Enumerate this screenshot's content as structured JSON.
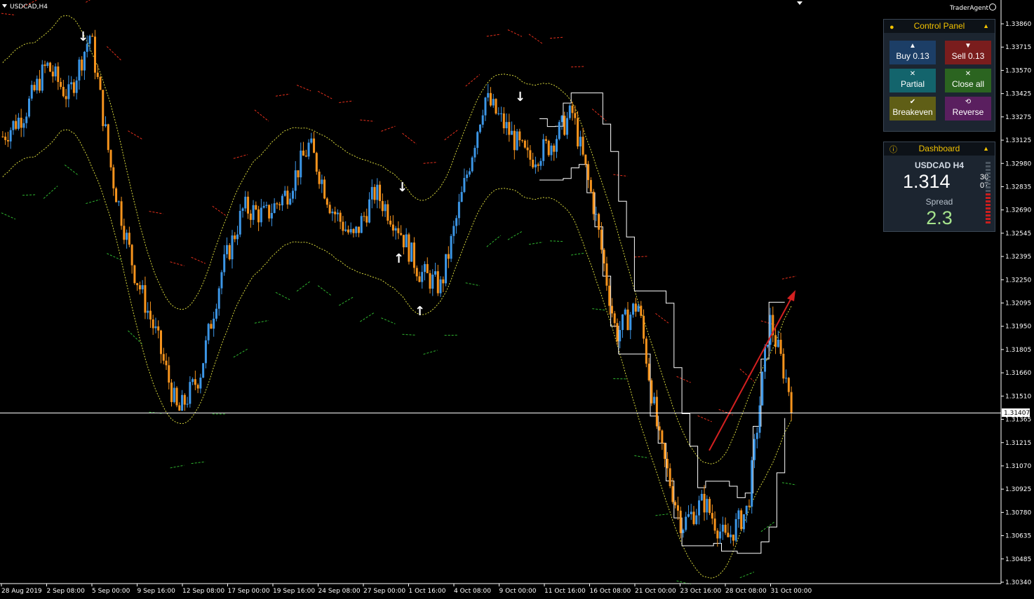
{
  "chart": {
    "title": "USDCAD,H4",
    "brand": "TraderAgent",
    "current_price_label": "1.31407",
    "price_levels": [
      "1.33860",
      "1.33715",
      "1.33570",
      "1.33425",
      "1.33275",
      "1.33125",
      "1.32980",
      "1.32835",
      "1.32690",
      "1.32545",
      "1.32395",
      "1.32250",
      "1.32095",
      "1.31950",
      "1.31805",
      "1.31660",
      "1.31510",
      "1.31365",
      "1.31215",
      "1.31070",
      "1.30925",
      "1.30780",
      "1.30635",
      "1.30485",
      "1.30340"
    ],
    "time_labels": [
      "28 Aug 2019",
      "2 Sep 08:00",
      "5 Sep 00:00",
      "9 Sep 16:00",
      "12 Sep 08:00",
      "17 Sep 00:00",
      "19 Sep 16:00",
      "24 Sep 08:00",
      "27 Sep 00:00",
      "1 Oct 16:00",
      "4 Oct 08:00",
      "9 Oct 00:00",
      "11 Oct 16:00",
      "16 Oct 08:00",
      "21 Oct 00:00",
      "23 Oct 16:00",
      "28 Oct 08:00",
      "31 Oct 00:00"
    ],
    "colors": {
      "bull": "#3c96e6",
      "bear": "#f7941d",
      "grid_line": "#ffffff",
      "resistance": "#e8301c",
      "support": "#2fb52f",
      "envelope": "#d8d83c",
      "trend_arrow": "#d42020"
    }
  },
  "chart_data": {
    "type": "candlestick",
    "symbol": "USDCAD",
    "timeframe": "H4",
    "ylim": [
      1.3034,
      1.3386
    ],
    "close_path": [
      1.3315,
      1.333,
      1.336,
      1.334,
      1.338,
      1.329,
      1.323,
      1.319,
      1.314,
      1.3165,
      1.323,
      1.327,
      1.3265,
      1.328,
      1.331,
      1.327,
      1.325,
      1.328,
      1.326,
      1.323,
      1.322,
      1.328,
      1.334,
      1.332,
      1.33,
      1.331,
      1.333,
      1.327,
      1.319,
      1.321,
      1.312,
      1.307,
      1.3085,
      1.306,
      1.308,
      1.32,
      1.315
    ],
    "current_price": 1.31407,
    "signal_arrows": [
      {
        "direction": "down",
        "price": 1.3378
      },
      {
        "direction": "down",
        "price": 1.334
      },
      {
        "direction": "down",
        "price": 1.3283
      },
      {
        "direction": "up",
        "price": 1.3238
      },
      {
        "direction": "up",
        "price": 1.3205
      }
    ]
  },
  "control_panel": {
    "title": "Control Panel",
    "buttons": [
      {
        "icon": "▲",
        "label": "Buy 0.13",
        "color": "#1c3e66"
      },
      {
        "icon": "▼",
        "label": "Sell 0.13",
        "color": "#7a1d1d"
      },
      {
        "icon": "✕",
        "label": "Partial",
        "color": "#13646c"
      },
      {
        "icon": "✕",
        "label": "Close all",
        "color": "#2b6420"
      },
      {
        "icon": "✔",
        "label": "Breakeven",
        "color": "#5f5e16"
      },
      {
        "icon": "⟲",
        "label": "Reverse",
        "color": "#5a1f5f"
      }
    ]
  },
  "dashboard": {
    "title": "Dashboard",
    "symbol": "USDCAD H4",
    "price_main": "1.314",
    "price_sup": "30",
    "price_sub": "07",
    "spread_label": "Spread",
    "spread_value": "2.3"
  }
}
